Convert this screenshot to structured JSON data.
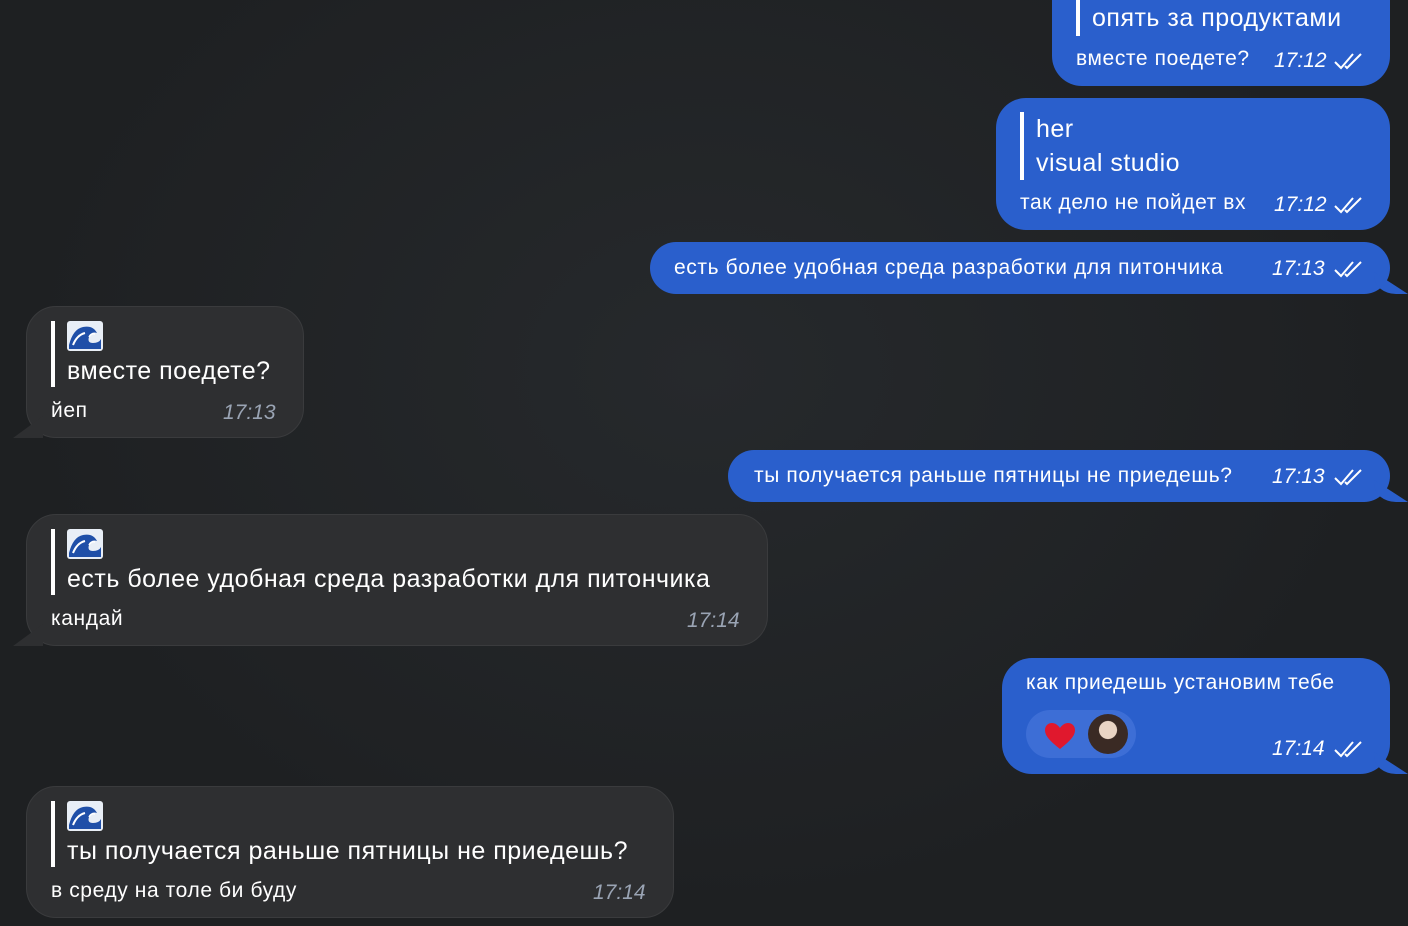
{
  "messages": {
    "m1": {
      "quote_text": "опять за продуктами",
      "text": "вместе поедете?",
      "time": "17:12"
    },
    "m2": {
      "quote_author": "her",
      "quote_text": "visual studio",
      "text": "так дело не пойдет вх",
      "time": "17:12"
    },
    "m3": {
      "text": "есть более удобная среда разработки для питончика",
      "time": "17:13"
    },
    "m4": {
      "quote_author_icon": "wave-emoji-icon",
      "quote_text": "вместе поедете?",
      "text": "йеп",
      "time": "17:13"
    },
    "m5": {
      "text": "ты получается раньше пятницы не приедешь?",
      "time": "17:13"
    },
    "m6": {
      "quote_author_icon": "wave-emoji-icon",
      "quote_text": "есть более удобная среда разработки для питончика",
      "text": "кандай",
      "time": "17:14"
    },
    "m7": {
      "text": "как приедешь установим тебе",
      "reaction": "heart-icon",
      "time": "17:14"
    },
    "m8": {
      "quote_author_icon": "wave-emoji-icon",
      "quote_text": "ты получается раньше пятницы не приедешь?",
      "text": "в среду на толе би буду",
      "time": "17:14"
    }
  },
  "colors": {
    "outgoing_bubble": "#2a5fcc",
    "incoming_bubble": "#2e2f31",
    "background": "#1f2123",
    "incoming_time": "#9aa4b4"
  }
}
